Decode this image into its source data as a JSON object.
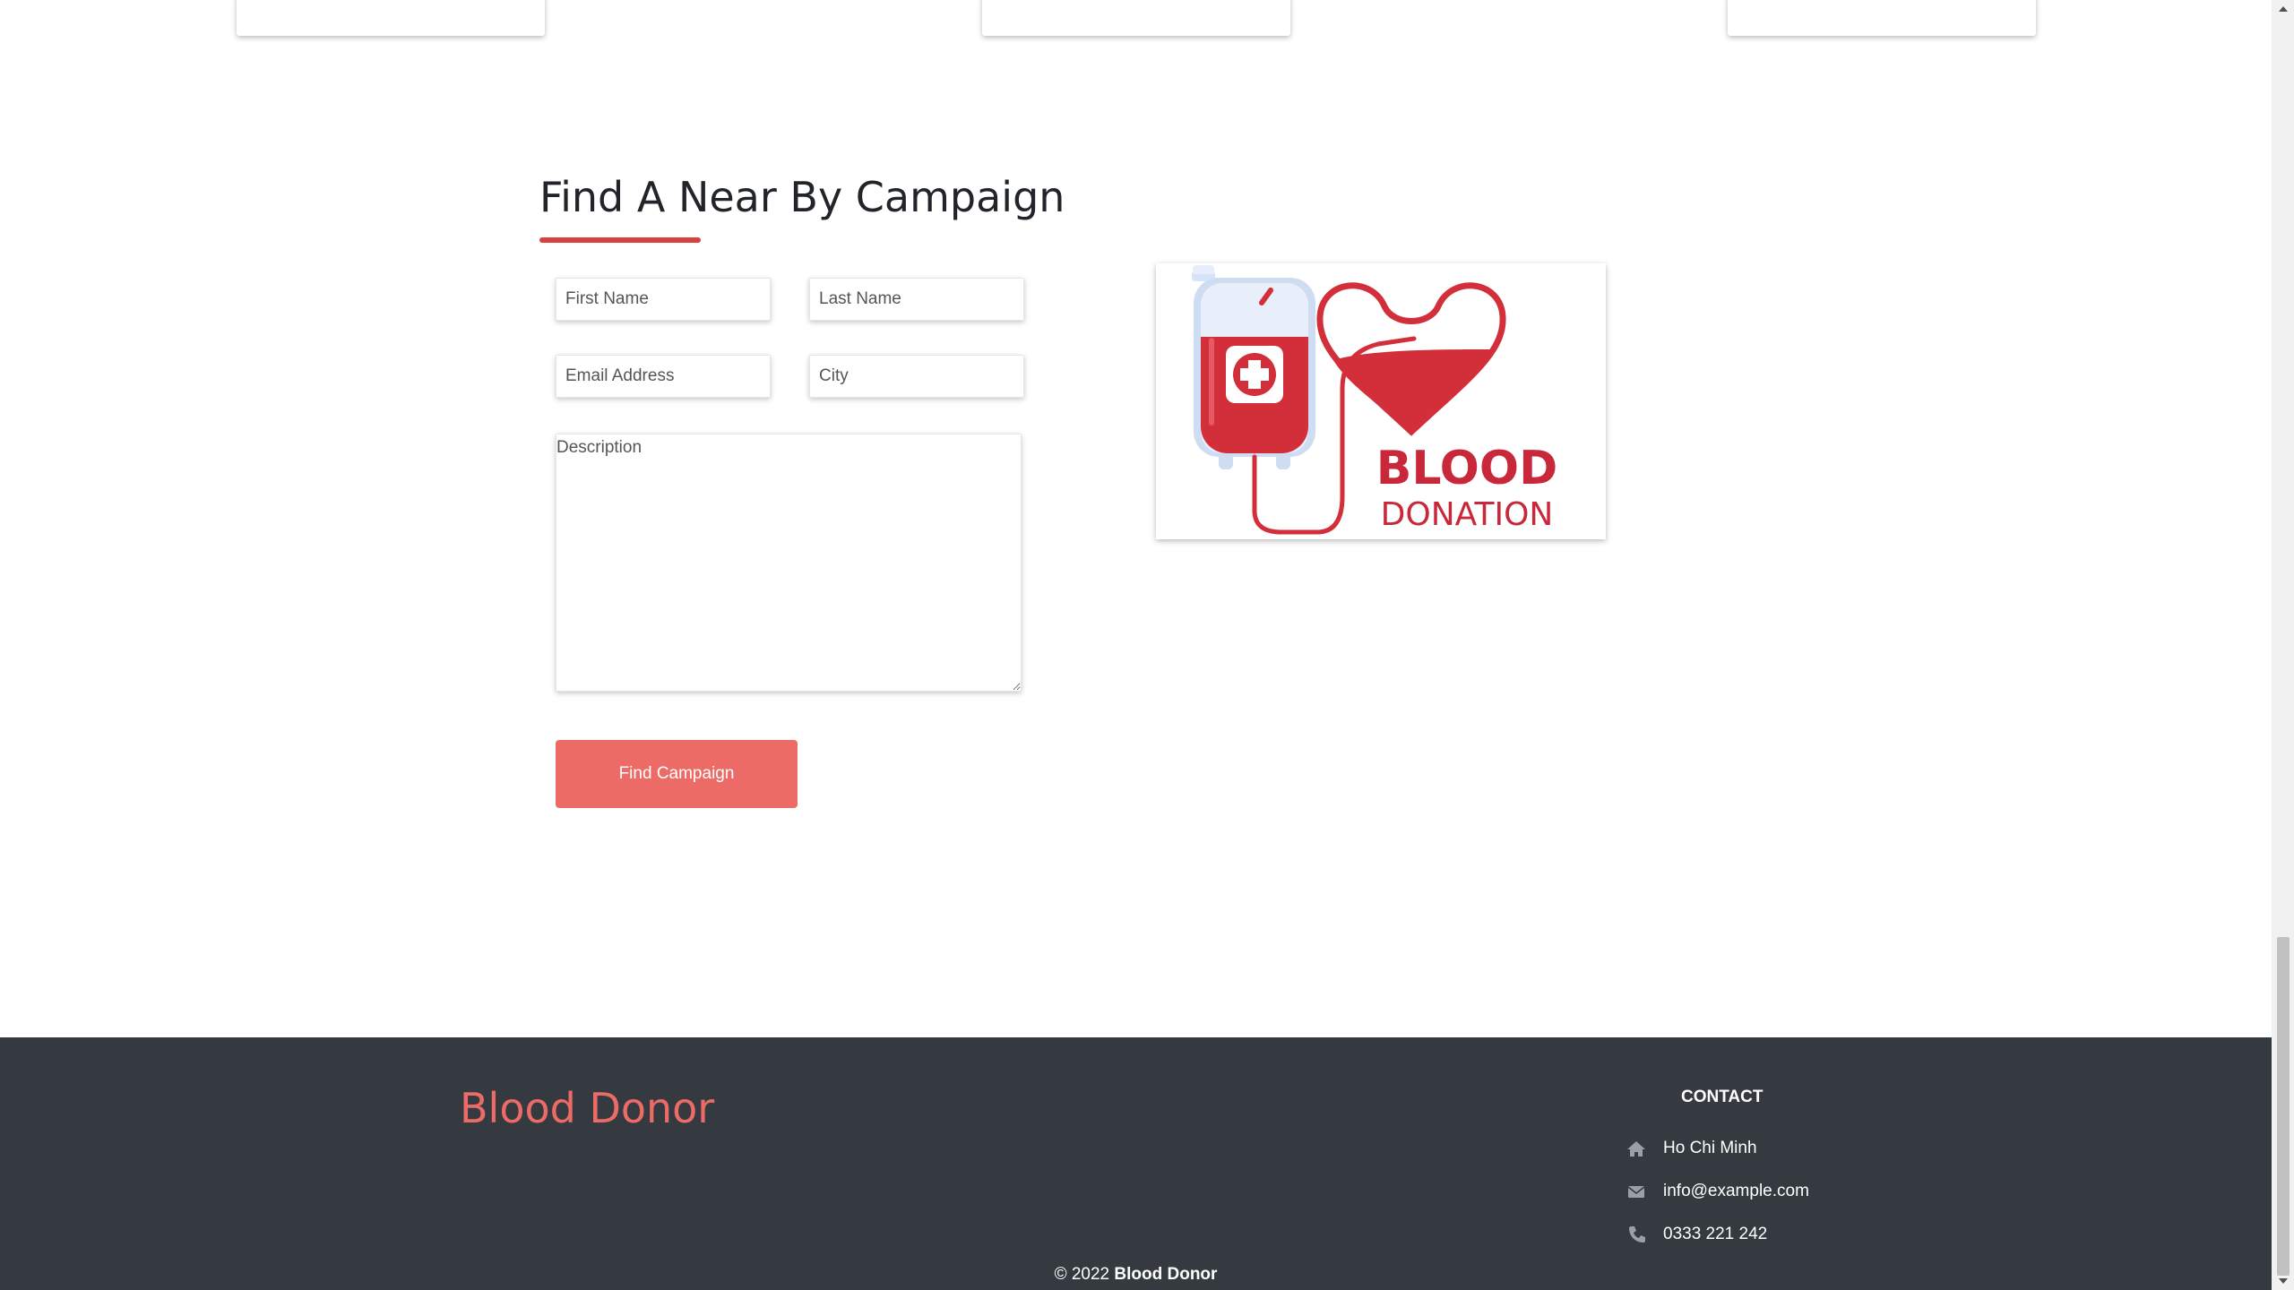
{
  "section": {
    "title": "Find A Near By Campaign"
  },
  "form": {
    "first_name_placeholder": "First Name",
    "last_name_placeholder": "Last Name",
    "email_placeholder": "Email Address",
    "city_placeholder": "City",
    "description_placeholder": "Description",
    "submit_label": "Find Campaign"
  },
  "illustration": {
    "line1": "BLOOD",
    "line2": "DONATION"
  },
  "footer": {
    "brand": "Blood Donor",
    "contact_title": "CONTACT",
    "contact": [
      {
        "icon": "home-icon",
        "text": "Ho Chi Minh"
      },
      {
        "icon": "envelope-icon",
        "text": "info@example.com"
      },
      {
        "icon": "phone-icon",
        "text": "0333 221 242"
      }
    ],
    "copyright_prefix": "© 2022",
    "copyright_brand": "Blood Donor"
  },
  "colors": {
    "accent": "#ec6b67",
    "underline": "#d9413f",
    "footer_bg": "#343a40",
    "blood_red": "#d32f3a"
  }
}
